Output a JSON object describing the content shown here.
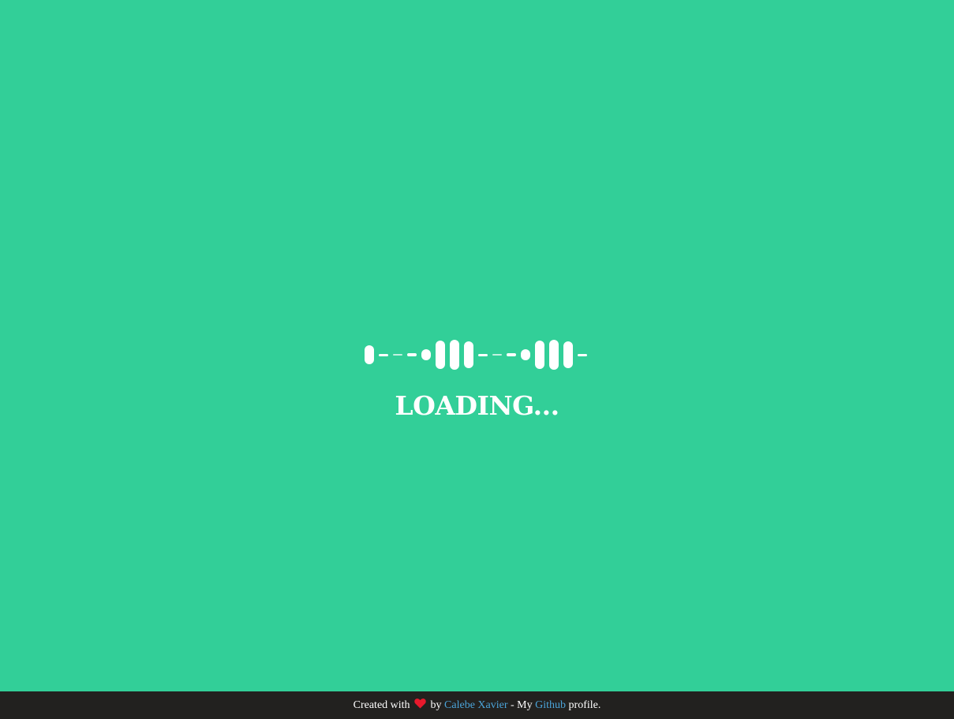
{
  "loader": {
    "label": "LOADING...",
    "bar_count": 16,
    "bar_color": "#ffffff"
  },
  "footer": {
    "created_with": "Created with",
    "heart_icon": "heart-icon",
    "heart_color": "#e8192c",
    "by": "by",
    "author_link": "Calebe Xavier",
    "my": "- My",
    "github_link": "Github",
    "profile": "profile.",
    "link_color": "#4ba4d9"
  },
  "colors": {
    "background": "#32cf98",
    "footer_background": "#22211f",
    "text": "#ffffff"
  }
}
